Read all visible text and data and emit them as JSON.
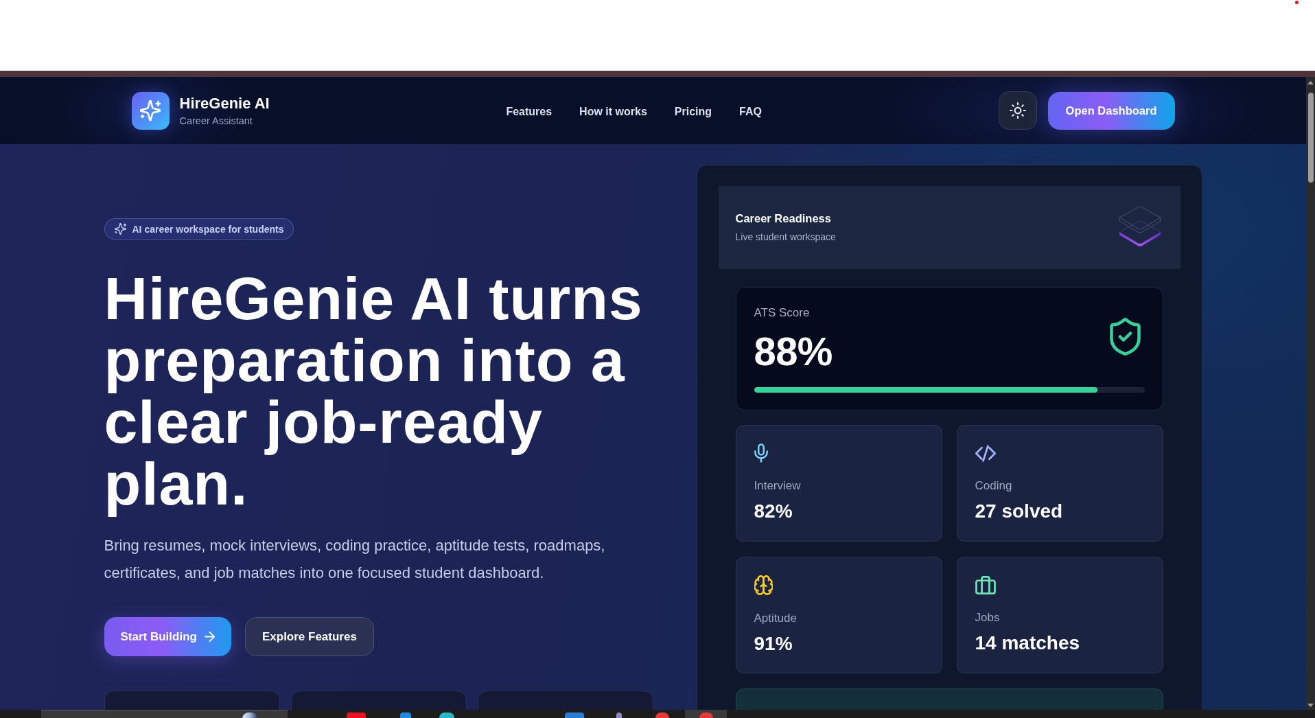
{
  "nav": {
    "brand": {
      "name": "HireGenie AI",
      "tagline": "Career Assistant"
    },
    "links": [
      "Features",
      "How it works",
      "Pricing",
      "FAQ"
    ],
    "cta": "Open Dashboard"
  },
  "hero": {
    "badge": "AI career workspace for students",
    "headline": "HireGenie AI turns preparation into a clear job-ready plan.",
    "description": "Bring resumes, mock interviews, coding practice, aptitude tests, roadmaps, certificates, and job matches into one focused student dashboard.",
    "buttons": [
      {
        "label": "Start Building",
        "kind": "primary"
      },
      {
        "label": "Explore Features",
        "kind": "secondary"
      }
    ]
  },
  "panel": {
    "title": "Career Readiness",
    "subtitle": "Live student workspace",
    "ats": {
      "label": "ATS Score",
      "value": "88%",
      "level": 0.88
    },
    "stats": [
      {
        "kind": "mic",
        "label": "Interview",
        "value": "82%",
        "color": "#7dd3fc"
      },
      {
        "kind": "code",
        "label": "Coding",
        "value": "27 solved",
        "color": "#a5b4fc"
      },
      {
        "kind": "brain",
        "label": "Aptitude",
        "value": "91%",
        "color": "#facc15"
      },
      {
        "kind": "briefcase",
        "label": "Jobs",
        "value": "14 matches",
        "color": "#6ee7b7"
      }
    ]
  }
}
